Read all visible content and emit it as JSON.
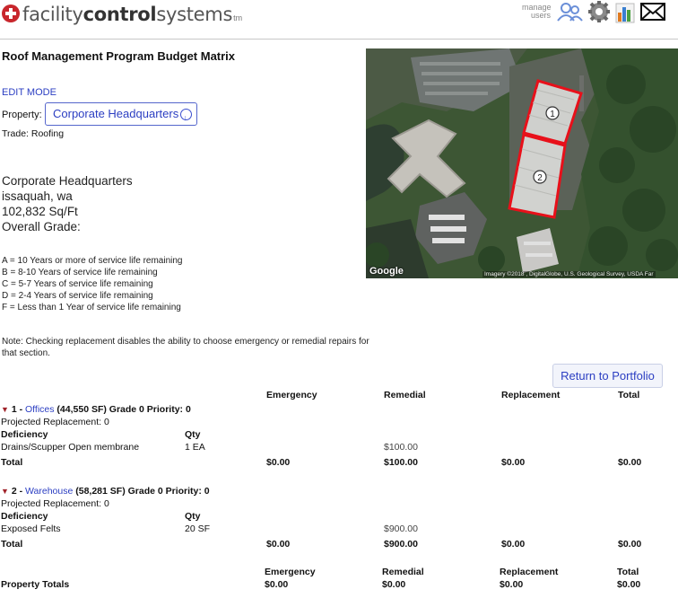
{
  "header": {
    "logo_light1": "facility",
    "logo_bold": "control",
    "logo_light2": "systems",
    "logo_tm": "tm",
    "manage_label_1": "manage",
    "manage_label_2": "users"
  },
  "page": {
    "title": "Roof Management Program Budget Matrix",
    "edit_mode": "EDIT MODE",
    "property_label": "Property:",
    "property_value": "Corporate Headquarters",
    "trade": "Trade: Roofing"
  },
  "property_info": {
    "name": "Corporate Headquarters",
    "location": "issaquah, wa",
    "area": "102,832 Sq/Ft",
    "grade": "Overall Grade:"
  },
  "grade_legend": [
    "A = 10 Years or more of service life remaining",
    "B = 8-10 Years of service life remaining",
    "C = 5-7 Years of service life remaining",
    "D = 2-4 Years of service life remaining",
    "F = Less than 1 Year of service life remaining"
  ],
  "note": "Note: Checking replacement disables the ability to choose emergency or remedial repairs for that section.",
  "map": {
    "provider": "Google",
    "imagery": "Imagery ©2018 , DigitalGlobe, U.S. Geological Survey, USDA Far",
    "markers": [
      "1",
      "2"
    ]
  },
  "return_button": "Return to Portfolio",
  "columns": [
    "Emergency",
    "Remedial",
    "Replacement",
    "Total"
  ],
  "sections": [
    {
      "prefix": "1 - ",
      "name": "Offices",
      "detail": " (44,550 SF) Grade 0 Priority: 0",
      "projected": "Projected Replacement: 0",
      "col_deficiency": "Deficiency",
      "col_qty": "Qty",
      "deficiency": "Drains/Scupper Open membrane",
      "qty": "1 EA",
      "remedial_cost": "$100.00",
      "total_label": "Total",
      "totals": [
        "$0.00",
        "$100.00",
        "$0.00",
        "$0.00"
      ]
    },
    {
      "prefix": "2 - ",
      "name": "Warehouse",
      "detail": " (58,281 SF) Grade 0 Priority: 0",
      "projected": "Projected Replacement: 0",
      "col_deficiency": "Deficiency",
      "col_qty": "Qty",
      "deficiency": "Exposed Felts",
      "qty": "20 SF",
      "remedial_cost": "$900.00",
      "total_label": "Total",
      "totals": [
        "$0.00",
        "$900.00",
        "$0.00",
        "$0.00"
      ]
    }
  ],
  "property_totals": {
    "label": "Property Totals",
    "headers": [
      "Emergency",
      "Remedial",
      "Replacement",
      "Total"
    ],
    "values": [
      "$0.00",
      "$0.00",
      "$0.00",
      "$0.00"
    ]
  },
  "colors": {
    "link": "#2b3ec2",
    "brand_red": "#c8262c",
    "marker": "#e8101a"
  }
}
